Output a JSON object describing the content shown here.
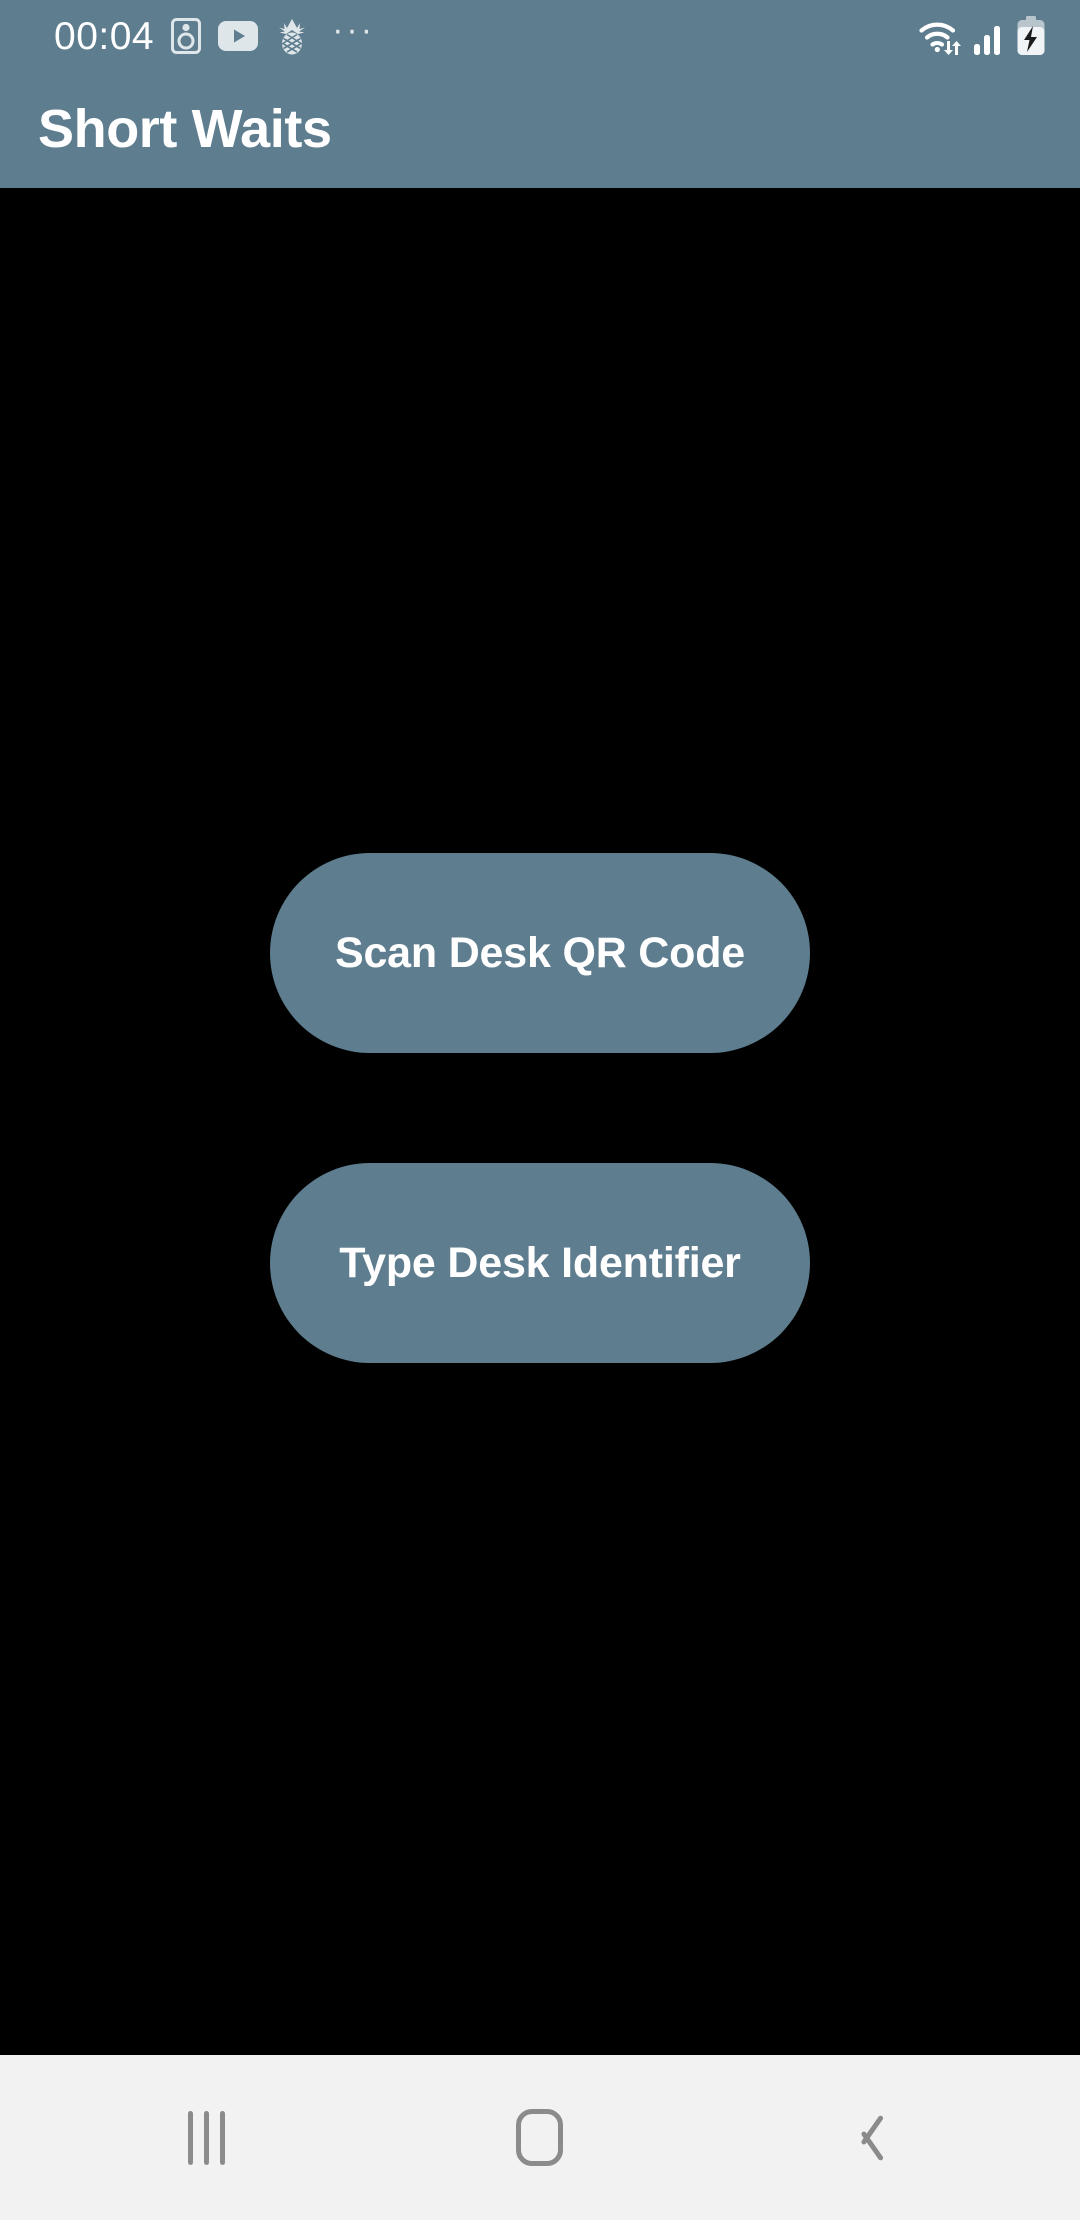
{
  "statusbar": {
    "clock": "00:04",
    "left_icons": [
      {
        "name": "speaker-icon",
        "label": "speaker"
      },
      {
        "name": "youtube-icon",
        "label": "youtube"
      },
      {
        "name": "pineapple-icon",
        "label": "pineapple"
      },
      {
        "name": "more-notifications-icon",
        "label": "···"
      }
    ],
    "more_glyph": "···",
    "right_icons": [
      {
        "name": "wifi-icon",
        "label": "wifi-data-transfer"
      },
      {
        "name": "cellular-signal-icon",
        "label": "signal-3-bars"
      },
      {
        "name": "battery-charging-icon",
        "label": "battery-charging"
      }
    ]
  },
  "header": {
    "title": "Short Waits"
  },
  "main": {
    "buttons": [
      {
        "label": "Scan Desk QR Code",
        "name": "scan-desk-qr-code-button"
      },
      {
        "label": "Type Desk Identifier",
        "name": "type-desk-identifier-button"
      }
    ]
  },
  "navbar": {
    "recents_label": "Recents",
    "home_label": "Home",
    "back_label": "Back"
  },
  "colors": {
    "accent": "#5e7d8f",
    "background": "#000000",
    "navbar": "#f2f2f2",
    "text_on_accent": "#ffffff",
    "nav_icon": "#8b8b8b"
  }
}
